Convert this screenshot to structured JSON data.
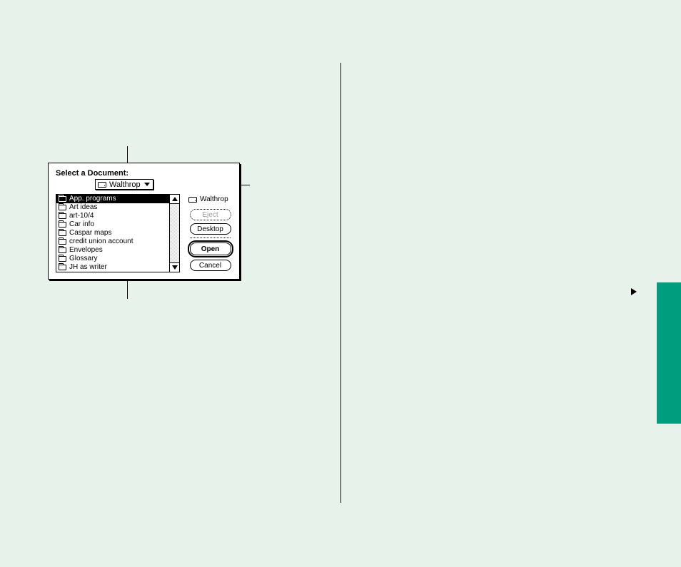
{
  "dialog": {
    "title": "Select a Document:",
    "popup": {
      "volume": "Walthrop"
    },
    "list": {
      "items": [
        "App. programs",
        "Art ideas",
        "art-10/4",
        "Car info",
        "Caspar maps",
        "credit union account",
        "Envelopes",
        "Glossary",
        "JH as writer"
      ],
      "selected_index": 0
    },
    "volume_label": "Walthrop",
    "buttons": {
      "eject": "Eject",
      "desktop": "Desktop",
      "open": "Open",
      "cancel": "Cancel"
    }
  }
}
